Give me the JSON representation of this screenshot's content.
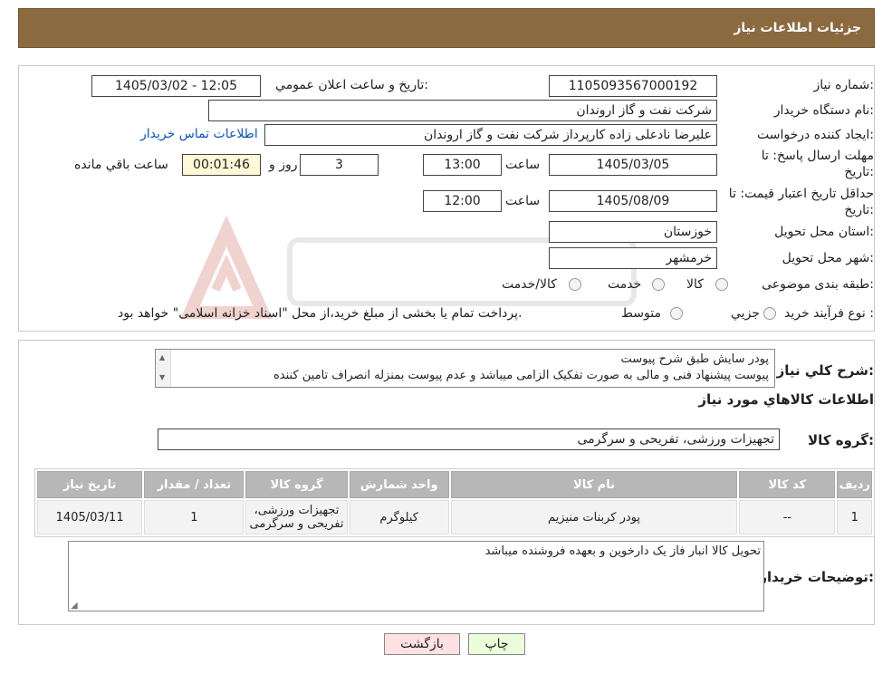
{
  "header": {
    "title": "جزئیات اطلاعات نیاز"
  },
  "need": {
    "number_label": "شماره نیاز:",
    "number": "1105093567000192",
    "announce_label": "تاریخ و ساعت اعلان عمومي:",
    "announce_value": "1405/03/02 - 12:05",
    "buyer_label": "نام دستگاه خريدار:",
    "buyer_value": "شرکت نفت و گاز اروندان",
    "creator_label": "ايجاد کننده درخواست:",
    "creator_value": "عليرضا نادعلی زاده کارپرداز شرکت نفت و گاز اروندان",
    "contact_link": "اطلاعات تماس خريدار",
    "deadline_label_1": "مهلت ارسال پاسخ: تا",
    "deadline_label_2": "تاريخ:",
    "deadline_date": "1405/03/05",
    "time_label": "ساعت",
    "deadline_time": "13:00",
    "days_value": "3",
    "days_label": "روز و",
    "remaining_value": "00:01:46",
    "remaining_label": "ساعت باقي مانده",
    "validity_label_1": "حداقل تاريخ اعتبار قيمت: تا",
    "validity_label_2": "تاريخ:",
    "validity_date": "1405/08/09",
    "validity_time": "12:00",
    "province_label": "استان محل تحويل:",
    "province_value": "خوزستان",
    "city_label": "شهر محل تحويل:",
    "city_value": "خرمشهر",
    "category_label": "طبقه بندی موضوعی:",
    "category_options": [
      "کالا",
      "خدمت",
      "کالا/خدمت"
    ],
    "process_label": "نوع فرآيند خريد :",
    "process_options": [
      "جزيي",
      "متوسط"
    ],
    "process_note": "پرداخت تمام يا بخشی از مبلغ خريد،از محل \"اسناد خزانه اسلامی\" خواهد بود."
  },
  "summary": {
    "label": "شرح کلي نياز:",
    "line1": "پودر سایش طبق شرح پیوست",
    "line2": "پیوست پیشنهاد فنی و مالی به صورت تفکیک الزامی میباشد و عدم پیوست بمنزله انصراف تامین کننده",
    "items_heading": "اطلاعات کالاهاي مورد نياز",
    "group_label": "گروه کالا:",
    "group_value": "تجهيزات ورزشی، تفريحی و سرگرمی"
  },
  "table": {
    "headers": [
      "رديف",
      "کد کالا",
      "نام کالا",
      "واحد شمارش",
      "گروه کالا",
      "تعداد / مقدار",
      "تاريخ نياز"
    ],
    "rows": [
      {
        "row": "1",
        "code": "--",
        "name": "پودر کربنات منیزیم",
        "unit": "کیلوگرم",
        "group_1": "تجهيزات ورزشی،",
        "group_2": "تفريحی و سرگرمی",
        "qty": "1",
        "date": "1405/03/11"
      }
    ]
  },
  "buyer_notes": {
    "label": "توضيحات خريدار:",
    "value": "تحویل کالا انبار فاز یک دارخوین و بعهده فروشنده میباشد"
  },
  "buttons": {
    "print": "چاپ",
    "back": "بازگشت"
  },
  "colors": {
    "header": "#8b6a3f",
    "print_button": "#eaffd9",
    "back_button": "#ffe1e1",
    "link": "#0b55c4"
  }
}
